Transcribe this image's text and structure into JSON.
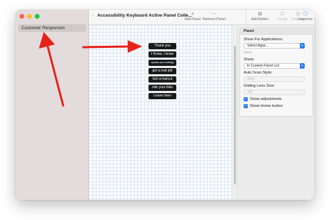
{
  "sidebar": {
    "items": [
      {
        "label": "Customer Responses",
        "selected": true
      }
    ]
  },
  "toolbar": {
    "title": "Accessibility Keyboard Active Panel Colle...",
    "back_icon": "chevron-left-icon",
    "buttons": [
      {
        "label": "Add Panel",
        "icon": "plus-icon",
        "glyph": "+"
      },
      {
        "label": "Remove Panel",
        "icon": "minus-icon",
        "glyph": "−"
      },
      {
        "label": "Add Button",
        "icon": "add-button-icon",
        "glyph": "⊞"
      },
      {
        "label": "Group",
        "icon": "group-icon",
        "glyph": "⊡"
      },
      {
        "label": "Ungroup",
        "icon": "ungroup-icon",
        "glyph": "⊟"
      },
      {
        "label": "Inspector",
        "icon": "info-icon",
        "glyph": "ⓘ"
      }
    ]
  },
  "canvas": {
    "buttons": [
      {
        "label": "Thank you"
      },
      {
        "label": "I Know, I know"
      },
      {
        "label": "Update your settings"
      },
      {
        "label": "get a real job"
      },
      {
        "label": "Get a haircut"
      },
      {
        "label": "ride your bike"
      },
      {
        "label": "Leave town"
      }
    ]
  },
  "inspector": {
    "panel_title": "Panel",
    "show_for_applications_label": "Show For Applications:",
    "applications_select": "Select Apps...",
    "none_text": "None",
    "show_label": "Show:",
    "show_select": "In Custom Panel List",
    "auto_scan_label": "Auto Scan Style:",
    "auto_scan_select": "Step",
    "gliding_lens_label": "Gliding Lens Size:",
    "gliding_lens_select": "1/8",
    "checkboxes": [
      {
        "label": "Show adjustments",
        "checked": true
      },
      {
        "label": "Show Home button",
        "checked": true
      }
    ]
  },
  "colors": {
    "accent": "#2a7bf4",
    "annotation_arrow": "#e8221a",
    "button_bg": "#1a1a1a"
  }
}
